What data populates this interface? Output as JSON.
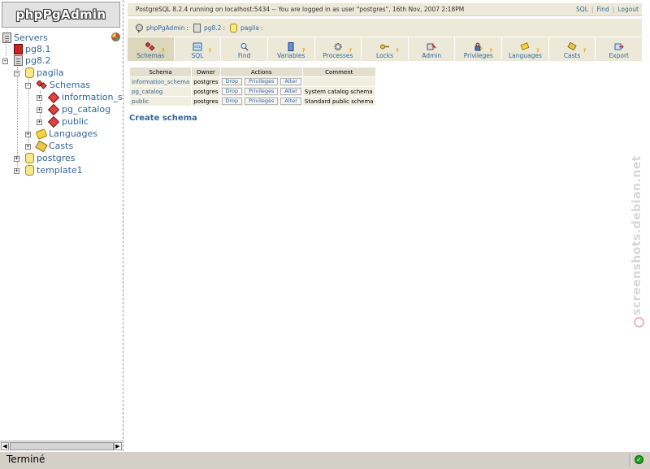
{
  "app": {
    "logo_text": "phpPgAdmin"
  },
  "tree": {
    "root_label": "Servers",
    "nodes": {
      "pg81": "pg8.1",
      "pg82": "pg8.2",
      "pagila": "pagila",
      "schemas": "Schemas",
      "information_schema": "information_schema",
      "pg_catalog": "pg_catalog",
      "public": "public",
      "languages": "Languages",
      "casts": "Casts",
      "postgres": "postgres",
      "template1": "template1"
    }
  },
  "topbar": {
    "message": "PostgreSQL 8.2.4 running on localhost:5434 -- You are logged in as user \"postgres\", 16th Nov, 2007 2:18PM",
    "links": [
      "SQL",
      "Find",
      "Logout"
    ],
    "separator": "|"
  },
  "trail": {
    "items": [
      "phpPgAdmin",
      "pg8.2",
      "pagila"
    ],
    "separator": ":"
  },
  "tabs": [
    {
      "key": "schemas",
      "label": "Schemas",
      "help": "?",
      "active": true
    },
    {
      "key": "sql",
      "label": "SQL",
      "help": "?",
      "active": false
    },
    {
      "key": "find",
      "label": "Find",
      "help": "",
      "active": false
    },
    {
      "key": "variables",
      "label": "Variables",
      "help": "?",
      "active": false
    },
    {
      "key": "processes",
      "label": "Processes",
      "help": "?",
      "active": false
    },
    {
      "key": "locks",
      "label": "Locks",
      "help": "?",
      "active": false
    },
    {
      "key": "admin",
      "label": "Admin",
      "help": "",
      "active": false
    },
    {
      "key": "privileges",
      "label": "Privileges",
      "help": "?",
      "active": false
    },
    {
      "key": "languages",
      "label": "Languages",
      "help": "?",
      "active": false
    },
    {
      "key": "casts",
      "label": "Casts",
      "help": "?",
      "active": false
    },
    {
      "key": "export",
      "label": "Export",
      "help": "",
      "active": false
    }
  ],
  "table": {
    "headers": [
      "Schema",
      "Owner",
      "Actions",
      "Comment"
    ],
    "rows": [
      {
        "schema": "information_schema",
        "owner": "postgres",
        "drop": "Drop",
        "privileges": "Privileges",
        "alter": "Alter",
        "comment": ""
      },
      {
        "schema": "pg_catalog",
        "owner": "postgres",
        "drop": "Drop",
        "privileges": "Privileges",
        "alter": "Alter",
        "comment": "System catalog schema"
      },
      {
        "schema": "public",
        "owner": "postgres",
        "drop": "Drop",
        "privileges": "Privileges",
        "alter": "Alter",
        "comment": "Standard public schema"
      }
    ]
  },
  "create_link": "Create schema",
  "watermark": "screenshots.debian.net",
  "statusbar": {
    "text": "Terminé"
  },
  "colors": {
    "link": "#336699",
    "panel": "#ece9d8",
    "active_tab": "#dcd6ba",
    "status_ok": "#20a020"
  }
}
